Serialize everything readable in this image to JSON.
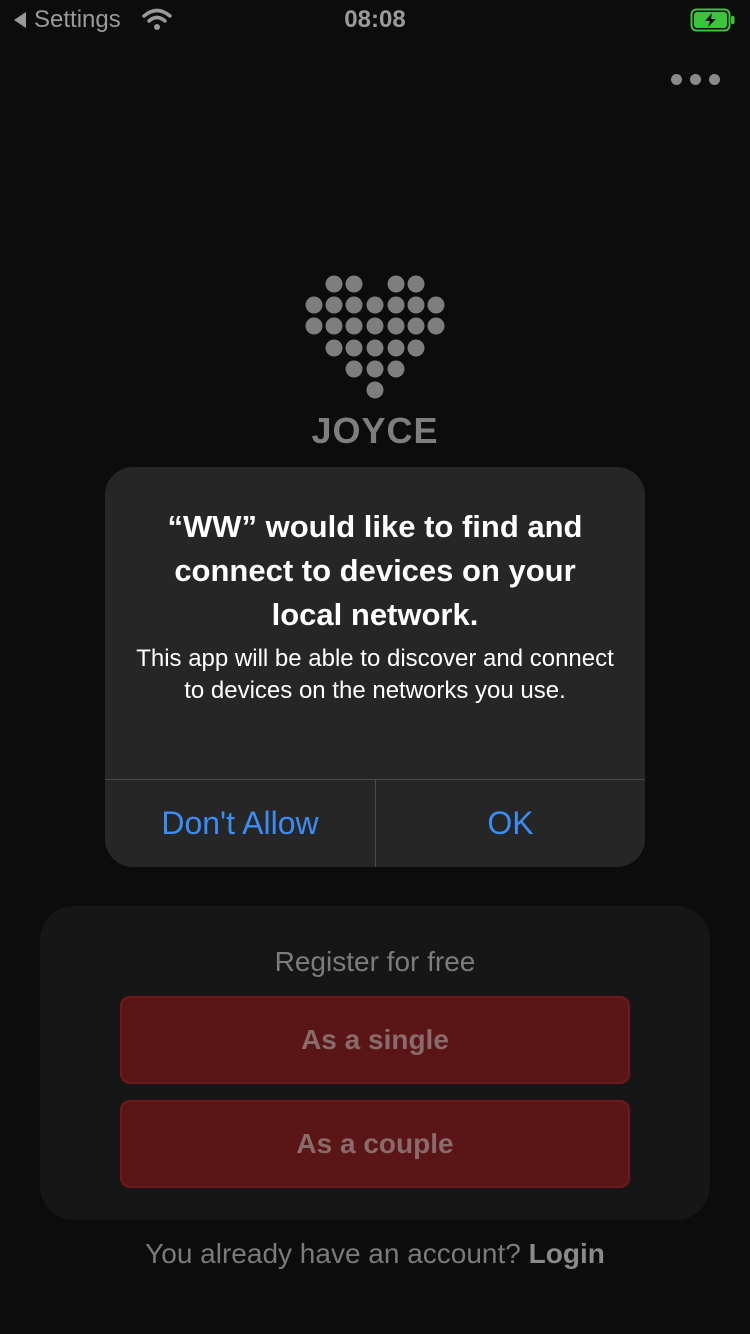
{
  "status_bar": {
    "back_label": "Settings",
    "time": "08:08",
    "icons": [
      "back-arrow-icon",
      "wifi-icon",
      "battery-charging-icon"
    ],
    "battery_color": "#3cc53c"
  },
  "header": {
    "more_icon": "more-horizontal-icon"
  },
  "logo": {
    "text": "JOYCE",
    "icon": "dotted-heart-logo",
    "color": "#7e7e7e"
  },
  "alert": {
    "title": "“WW” would like to find and connect to devices on your local network.",
    "message": "This app will be able to discover and connect to devices on the networks you use.",
    "deny_label": "Don't Allow",
    "ok_label": "OK",
    "button_color": "#3b8df5"
  },
  "register": {
    "title": "Register for free",
    "single_label": "As a single",
    "couple_label": "As a couple",
    "button_color": "#5a1616"
  },
  "login": {
    "prompt": "You already have an account? ",
    "link_label": "Login"
  }
}
